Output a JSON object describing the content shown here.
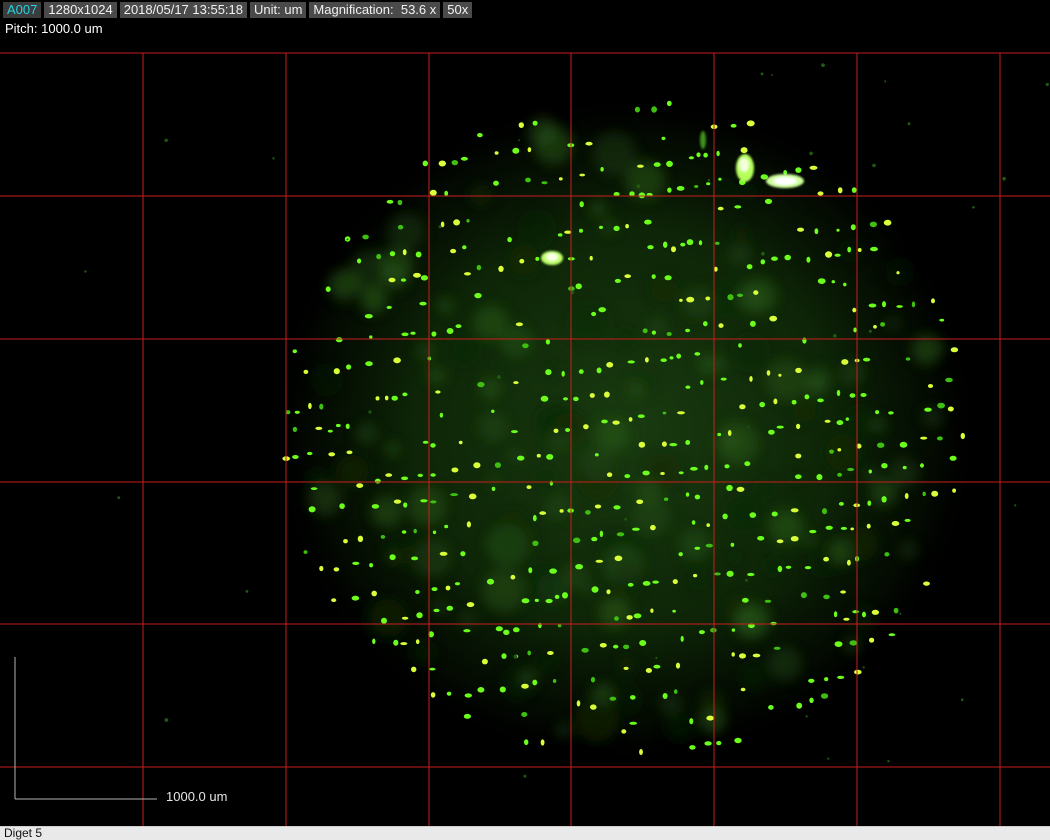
{
  "header": {
    "tags": [
      {
        "name": "image-id-tag",
        "text": "A007",
        "accent": true
      },
      {
        "name": "resolution-tag",
        "text": "1280x1024",
        "accent": false
      },
      {
        "name": "timestamp-tag",
        "text": "2018/05/17 13:55:18",
        "accent": false
      },
      {
        "name": "unit-tag",
        "text": "Unit: um",
        "accent": false
      },
      {
        "name": "magnification-tag",
        "text": "Magnification:  53.6 x",
        "accent": false
      },
      {
        "name": "objective-tag",
        "text": "50x",
        "accent": false
      }
    ],
    "pitch": "Pitch: 1000.0 um"
  },
  "scale_bar": {
    "label": "1000.0 um"
  },
  "status_bar": {
    "text": "Diget 5"
  },
  "colors": {
    "grid_line": "#c81e1e",
    "spot_green": "#6cff1e",
    "spot_yellow": "#d8ff3a",
    "tag_background": "#4a4a4a",
    "tag_accent_text": "#22d3e0",
    "status_background": "#e9e9e9"
  }
}
